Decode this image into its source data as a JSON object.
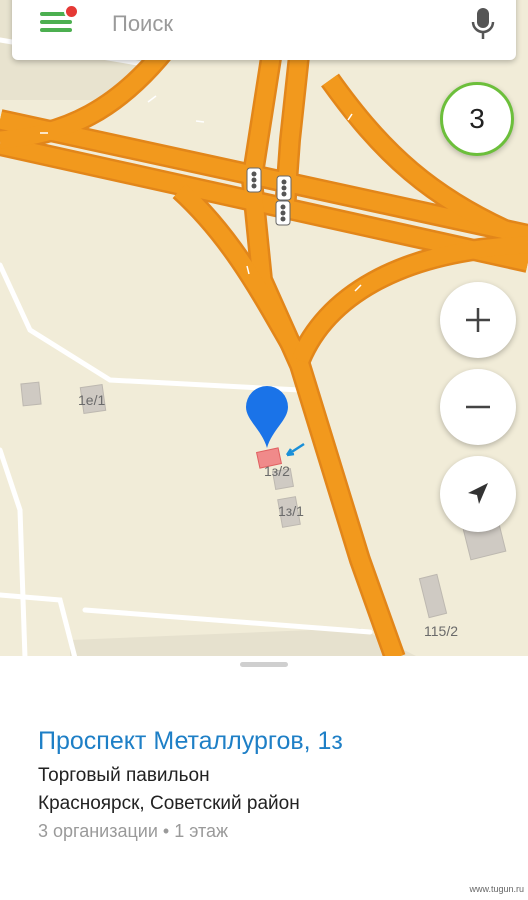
{
  "search": {
    "placeholder": "Поиск"
  },
  "layers": {
    "count": "3"
  },
  "map_labels": [
    "1е/1",
    "1з/2",
    "1з/1",
    "115/2"
  ],
  "sheet": {
    "title": "Проспект Металлургов, 1з",
    "type": "Торговый павильон",
    "location": "Красноярск, Советский район",
    "meta": "3 организации • 1 этаж"
  },
  "watermark": "www.tugun.ru",
  "colors": {
    "accent": "#1e7fc6",
    "menu": "#4caf50",
    "road": "#f2991d",
    "land": "#f1ecd8",
    "pin": "#1a73e8"
  },
  "icons": [
    "menu-icon",
    "notification-dot",
    "mic-icon",
    "zoom-in-icon",
    "zoom-out-icon",
    "location-arrow-icon",
    "map-pin-icon",
    "traffic-light-icon"
  ]
}
